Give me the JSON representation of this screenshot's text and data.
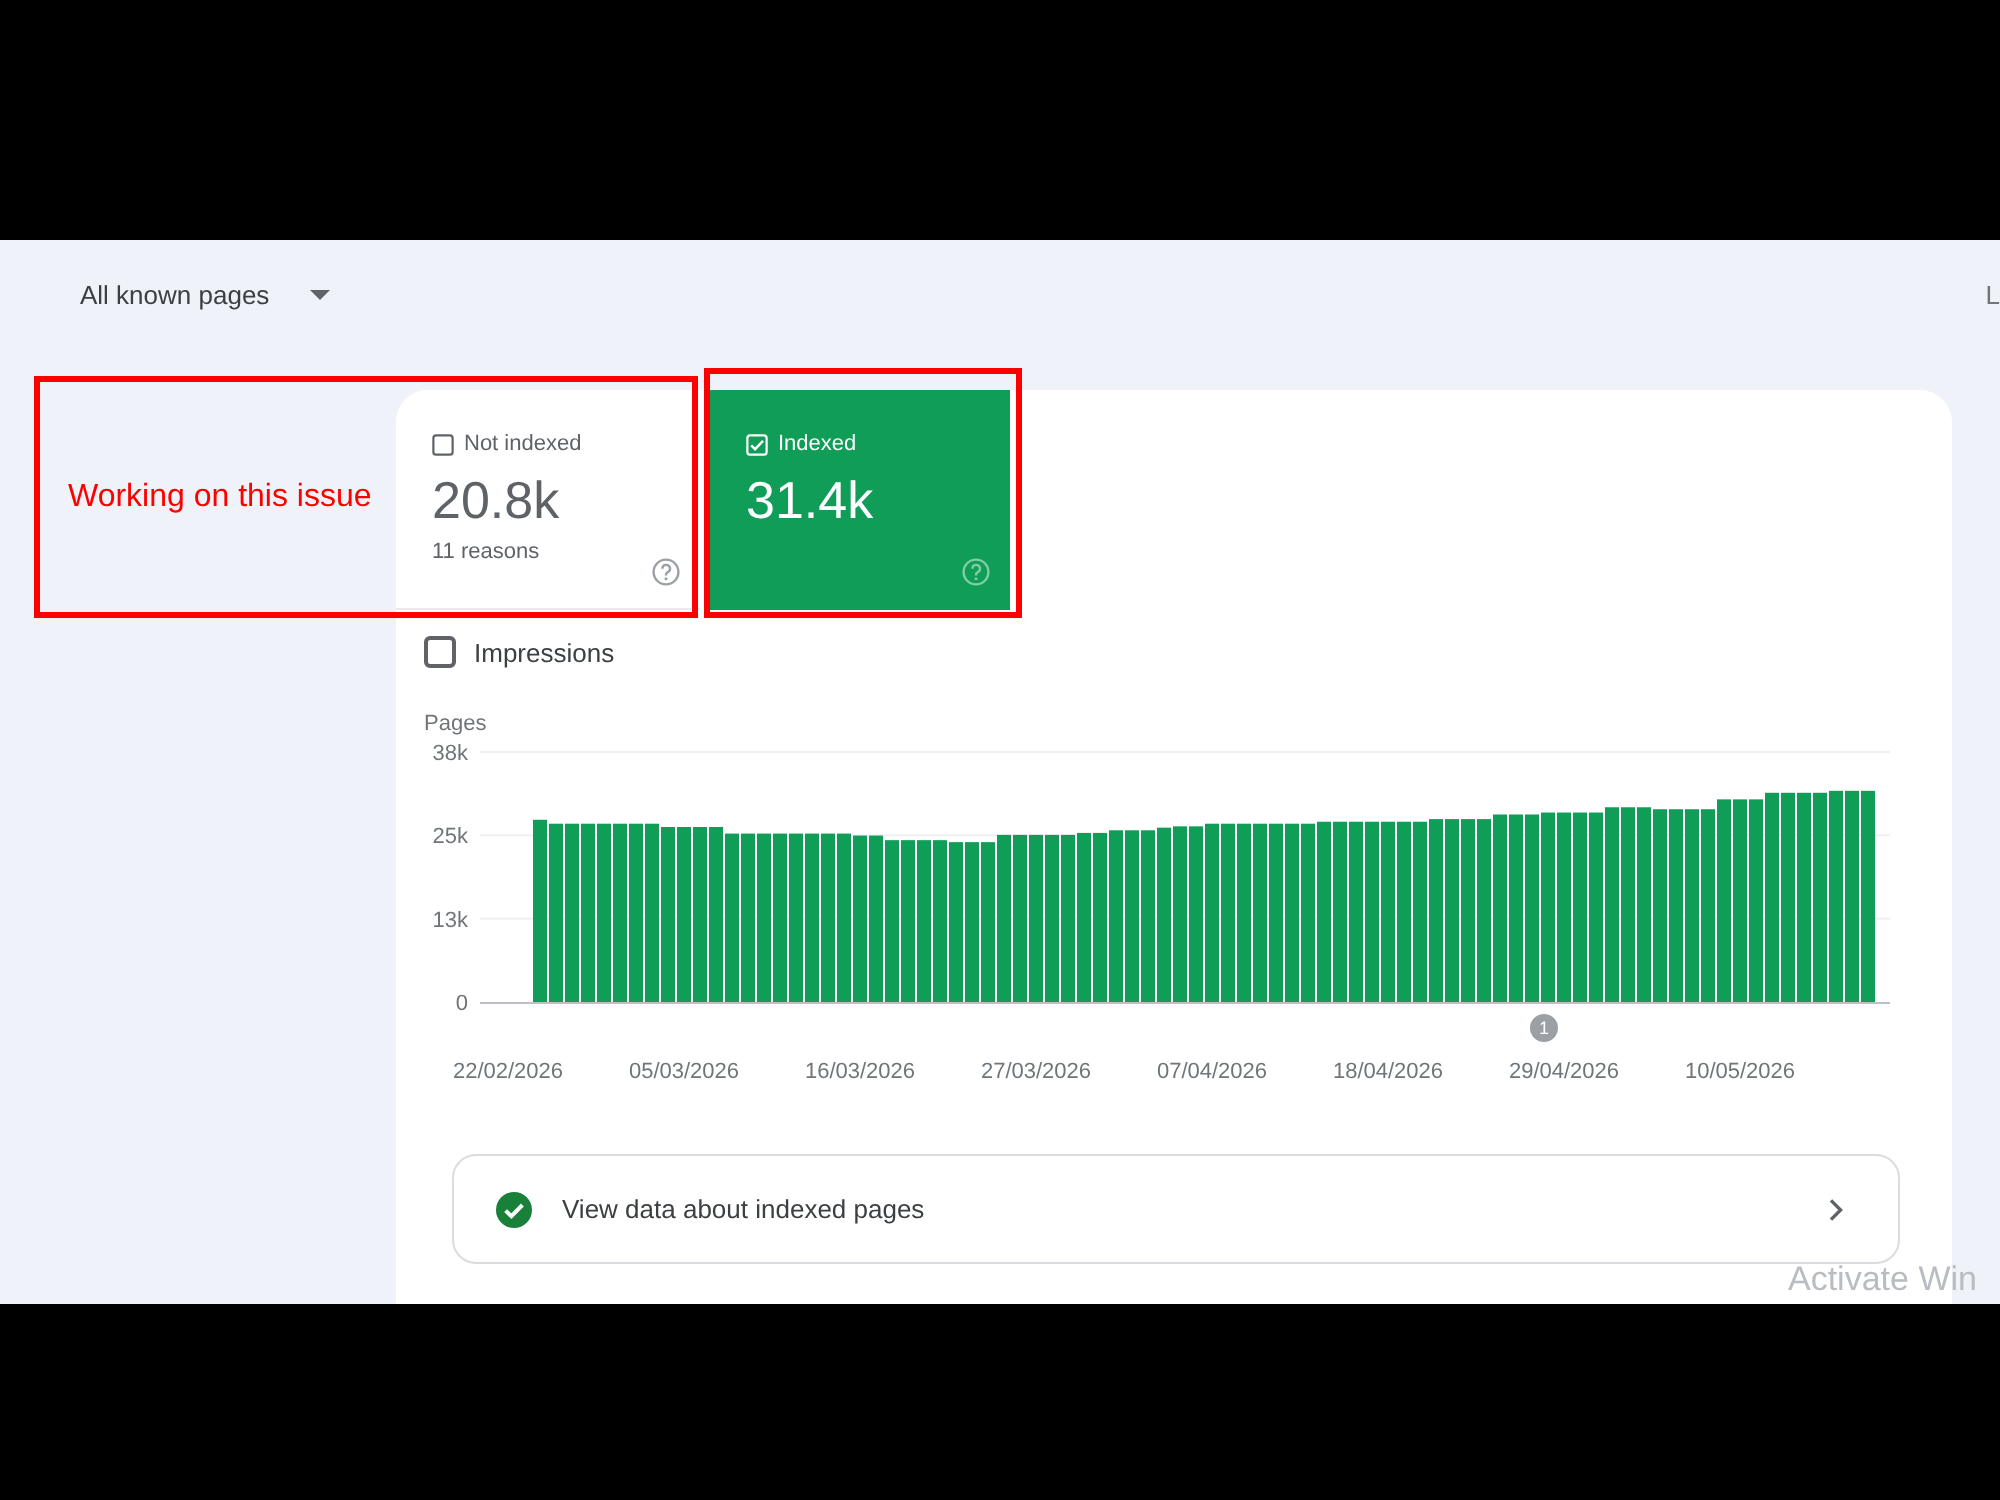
{
  "header": {
    "filter": {
      "label": "All known pages"
    },
    "edge_text": "L"
  },
  "tiles": [
    {
      "label": "Not indexed",
      "value": "20.8k",
      "subtitle": "11 reasons",
      "selected": false,
      "checked": false,
      "outlined": true,
      "outline_note": "Working on this issue"
    },
    {
      "label": "Indexed",
      "value": "31.4k",
      "selected": true,
      "checked": true,
      "outlined": true
    }
  ],
  "impressions": {
    "label": "Impressions",
    "checked": false
  },
  "chart_data": {
    "type": "bar",
    "ylabel": "Pages",
    "ylim": [
      0,
      38000
    ],
    "yticks": [
      {
        "value": 0,
        "label": "0"
      },
      {
        "value": 12667,
        "label": "13k"
      },
      {
        "value": 25333,
        "label": "25k"
      },
      {
        "value": 38000,
        "label": "38k"
      }
    ],
    "categories": [
      "22/02/2026",
      null,
      null,
      null,
      null,
      null,
      null,
      null,
      null,
      null,
      null,
      "05/03/2026",
      null,
      null,
      null,
      null,
      null,
      null,
      null,
      null,
      null,
      null,
      "16/03/2026",
      null,
      null,
      null,
      null,
      null,
      null,
      null,
      null,
      null,
      null,
      "27/03/2026",
      null,
      null,
      null,
      null,
      null,
      null,
      null,
      null,
      null,
      null,
      "07/04/2026",
      null,
      null,
      null,
      null,
      null,
      null,
      null,
      null,
      null,
      null,
      "18/04/2026",
      null,
      null,
      null,
      null,
      null,
      null,
      null,
      null,
      null,
      null,
      "29/04/2026",
      null,
      null,
      null,
      null,
      null,
      null,
      null,
      null,
      null,
      null,
      "10/05/2026",
      null,
      null,
      null,
      null,
      null,
      null,
      null,
      null
    ],
    "values": [
      null,
      null,
      27700,
      27100,
      27100,
      27100,
      27100,
      27100,
      27100,
      27100,
      26600,
      26600,
      26600,
      26600,
      25600,
      25600,
      25600,
      25600,
      25600,
      25600,
      25600,
      25600,
      25300,
      25300,
      24600,
      24600,
      24600,
      24600,
      24300,
      24300,
      24300,
      25400,
      25400,
      25400,
      25400,
      25400,
      25700,
      25700,
      26100,
      26100,
      26100,
      26500,
      26700,
      26700,
      27100,
      27100,
      27100,
      27100,
      27100,
      27100,
      27100,
      27400,
      27400,
      27400,
      27400,
      27400,
      27400,
      27400,
      27800,
      27800,
      27800,
      27800,
      28500,
      28500,
      28500,
      28800,
      28800,
      28800,
      28800,
      29600,
      29600,
      29600,
      29300,
      29300,
      29300,
      29300,
      30800,
      30800,
      30800,
      31800,
      31800,
      31800,
      31800,
      32100,
      32100,
      32100
    ],
    "annotations": [
      "1"
    ]
  },
  "details_link": {
    "label": "View data about indexed pages"
  },
  "system_overlay": {
    "text": "Activate Win"
  }
}
